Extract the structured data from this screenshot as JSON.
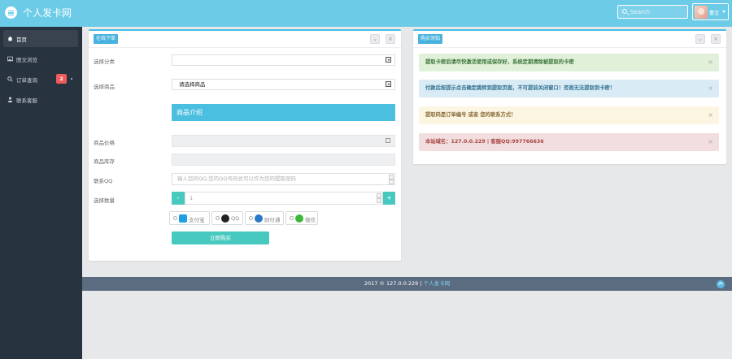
{
  "header": {
    "site_title": "个人发卡网",
    "search_placeholder": "Search",
    "user_name": "曹宝"
  },
  "sidebar": {
    "items": [
      {
        "label": "首页",
        "icon": "home-icon"
      },
      {
        "label": "图文浏览",
        "icon": "image-icon"
      },
      {
        "label": "订单查询",
        "icon": "search-icon",
        "badge": "2"
      },
      {
        "label": "联系客服",
        "icon": "user-icon"
      }
    ]
  },
  "order_panel": {
    "title": "在线下单",
    "category_label": "选择分类",
    "category_value": "",
    "product_label": "选择商品",
    "product_value": "请选择商品",
    "description_title": "商品介绍",
    "price_label": "商品价格",
    "stock_label": "商品库存",
    "qq_label": "联系QQ",
    "qq_placeholder": "输入您的QQ,您的QQ号码也可以作为您的提取密码",
    "quantity_label": "选择数量",
    "quantity_value": "1",
    "minus": "-",
    "plus": "+",
    "payment_methods": [
      {
        "label": "支付宝",
        "icon": "alipay-icon",
        "color": "#1d9fe2"
      },
      {
        "label": "QQ",
        "icon": "qq-icon",
        "color": "#222222"
      },
      {
        "label": "财付通",
        "icon": "tenpay-icon",
        "color": "#2a79c9"
      },
      {
        "label": "微信",
        "icon": "wechat-icon",
        "color": "#3fb83a"
      }
    ],
    "buy_button": "立即购买"
  },
  "notice_panel": {
    "title": "购买须知",
    "alerts": [
      {
        "text": "提取卡密后请尽快激活使用或保存好，系统定期清除被提取的卡密",
        "type": "success",
        "bg": "#e1f0d8",
        "color": "#3c763d"
      },
      {
        "text": "付款后按提示点击确定跳转到提取页面，不可提前关闭窗口！否则无法提取到卡密！",
        "type": "info",
        "bg": "#d9ecf6",
        "color": "#31708f"
      },
      {
        "text": "提取码是订单编号 或者 您的联系方式！",
        "type": "warning",
        "bg": "#fcf5e1",
        "color": "#8a6d3b"
      },
      {
        "text": "本站域名：127.0.0.229 | 客服QQ:997766636",
        "type": "danger",
        "bg": "#f2dede",
        "color": "#a94442"
      }
    ],
    "close_symbol": "×"
  },
  "footer": {
    "text": "2017 © 127.0.0.229 | ",
    "link": "个人发卡网"
  }
}
